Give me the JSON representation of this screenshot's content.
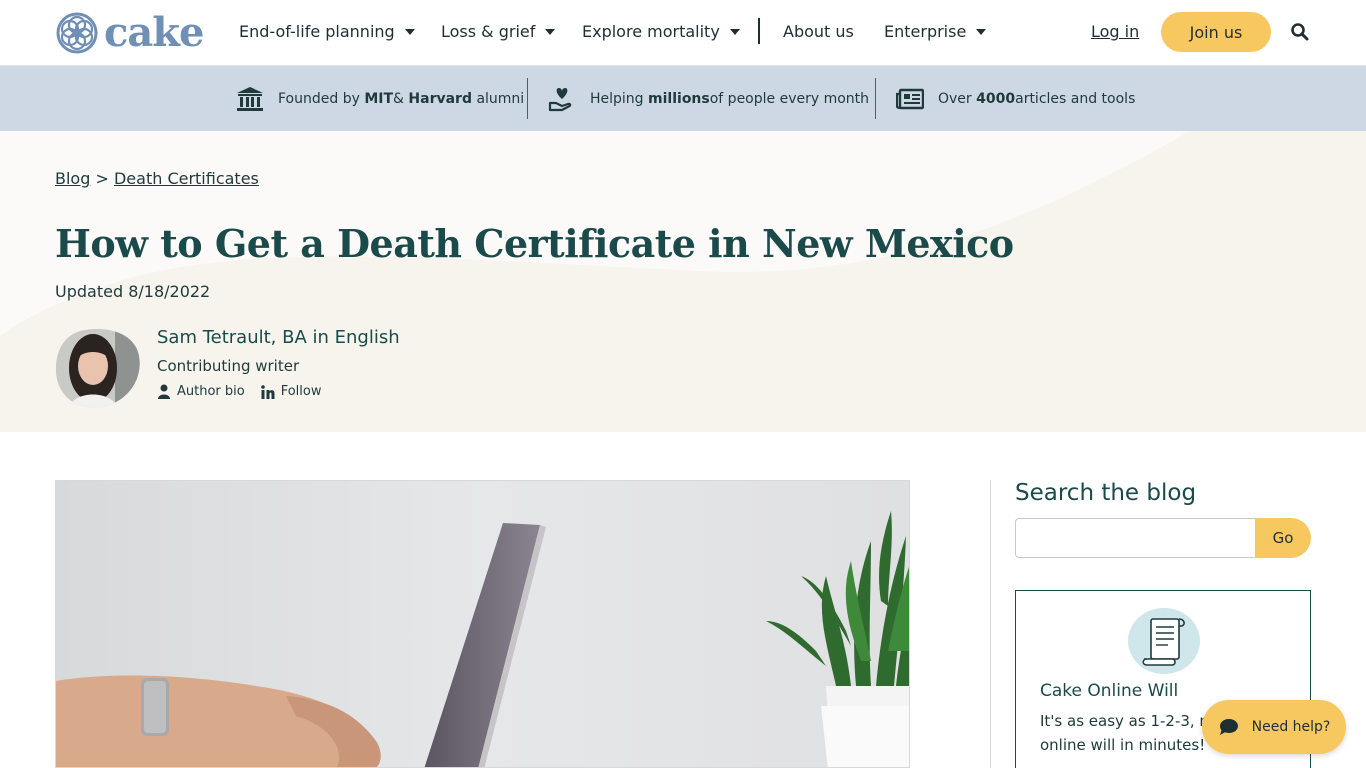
{
  "header": {
    "logo_text": "cake",
    "nav": [
      {
        "label": "End-of-life planning",
        "has_menu": true
      },
      {
        "label": "Loss & grief",
        "has_menu": true
      },
      {
        "label": "Explore mortality",
        "has_menu": true
      },
      {
        "label": "About us",
        "has_menu": false
      },
      {
        "label": "Enterprise",
        "has_menu": true
      }
    ],
    "login_label": "Log in",
    "join_label": "Join us",
    "search_icon": "search-icon"
  },
  "trust": [
    {
      "icon": "institution-icon",
      "pre": "Founded by ",
      "b1": "MIT",
      "mid": " & ",
      "b2": "Harvard",
      "post": " alumni"
    },
    {
      "icon": "heart-hand-icon",
      "pre": "Helping ",
      "b1": "millions",
      "mid": " of people every month",
      "b2": "",
      "post": ""
    },
    {
      "icon": "newspaper-icon",
      "pre": "Over ",
      "b1": "4000",
      "mid": " articles and tools",
      "b2": "",
      "post": ""
    }
  ],
  "breadcrumb": {
    "items": [
      "Blog",
      "Death Certificates"
    ],
    "separator": ">"
  },
  "article": {
    "title": "How to Get a Death Certificate in New Mexico",
    "updated": "Updated 8/18/2022",
    "author_name": "Sam Tetrault, BA in English",
    "author_role": "Contributing writer",
    "author_bio_label": "Author bio",
    "follow_label": "Follow"
  },
  "sidebar": {
    "search_title": "Search the blog",
    "search_placeholder": "",
    "go_label": "Go",
    "will_title": "Cake Online Will",
    "will_desc": "It's as easy as 1-2-3, make your online will in minutes!"
  },
  "help_label": "Need help?",
  "colors": {
    "accent_yellow": "#f8c860",
    "brand_teal": "#1b4a4a",
    "trust_bar": "#cdd8e4",
    "hero_bg": "#f7f4ee"
  }
}
